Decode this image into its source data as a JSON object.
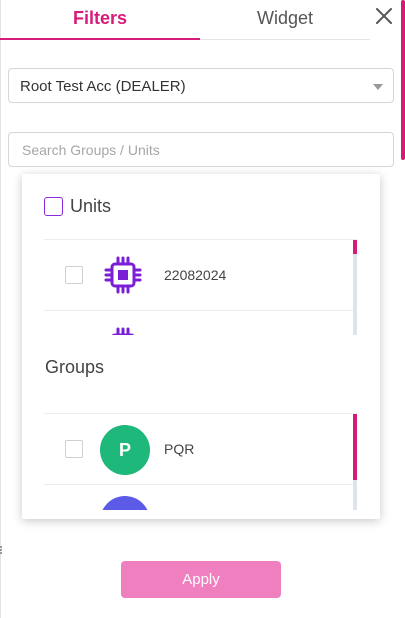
{
  "tabs": [
    {
      "label": "Filters",
      "active": true
    },
    {
      "label": "Widget",
      "active": false
    }
  ],
  "close_icon": "close-icon",
  "account_select": {
    "value": "Root Test Acc (DEALER)"
  },
  "search": {
    "placeholder": "Search Groups / Units",
    "value": ""
  },
  "units": {
    "title": "Units",
    "checked": false,
    "items": [
      {
        "label": "22082024",
        "icon": "chip-icon",
        "checked": false
      },
      {
        "label": "",
        "icon": "chip-icon",
        "checked": false
      }
    ]
  },
  "groups": {
    "title": "Groups",
    "items": [
      {
        "label": "PQR",
        "initial": "P",
        "avatar_color": "#1db87a",
        "checked": false
      },
      {
        "label": "",
        "initial": "",
        "avatar_color": "#5b5be8",
        "checked": false
      }
    ]
  },
  "apply_label": "Apply",
  "colors": {
    "accent": "#d81b7a",
    "apply_button": "#f07fbf",
    "chip_icon": "#7b1fd6",
    "checkbox_units": "#8a2be2"
  }
}
